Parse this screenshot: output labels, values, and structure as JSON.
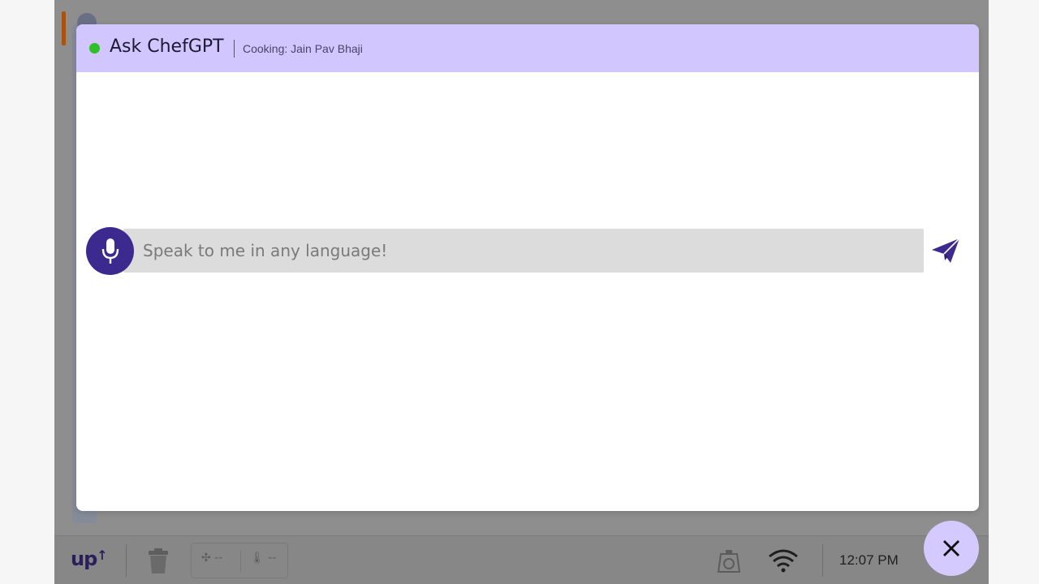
{
  "modal": {
    "title": "Ask ChefGPT",
    "subtitle": "Cooking: Jain Pav Bhaji",
    "status_color": "#2ec02b",
    "header_color": "#d2c6fe"
  },
  "chat": {
    "input_placeholder": "Speak to me in any language!",
    "input_value": "",
    "mic_icon": "microphone-icon",
    "send_icon": "paper-plane-icon",
    "accent_color": "#3d2a8e"
  },
  "statusbar": {
    "logo": "up",
    "fan_value": "--",
    "temp_value": "--",
    "time": "12:07 PM",
    "icons": [
      "trash-icon",
      "fan-icon",
      "thermometer-icon",
      "scale-icon",
      "wifi-icon"
    ]
  },
  "close_fab": {
    "icon": "close-icon"
  }
}
